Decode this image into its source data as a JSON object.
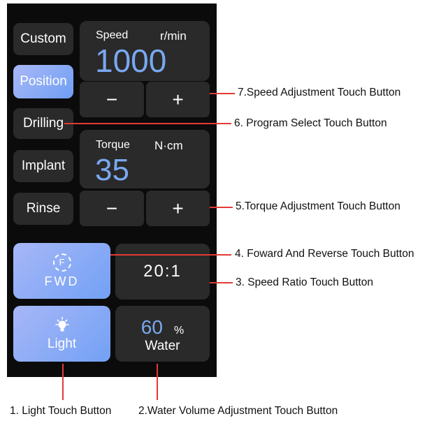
{
  "programs": [
    "Custom",
    "Position",
    "Drilling",
    "Implant",
    "Rinse"
  ],
  "speed": {
    "label": "Speed",
    "unit": "r/min",
    "value": "1000",
    "minus": "−",
    "plus": "+"
  },
  "torque": {
    "label": "Torque",
    "unit": "N·cm",
    "value": "35",
    "minus": "−",
    "plus": "+"
  },
  "fwd": {
    "icon_letter": "F",
    "label": "FWD"
  },
  "ratio": {
    "value": "20:1"
  },
  "light": {
    "label": "Light"
  },
  "water": {
    "value": "60",
    "unit": "%",
    "label": "Water"
  },
  "callouts": {
    "speed_adjust": "7.Speed Adjustment Touch Button",
    "program_select": "6. Program Select Touch Button",
    "torque_adjust": "5.Torque Adjustment Touch Button",
    "fwd_rev": "4. Foward And Reverse Touch Button",
    "speed_ratio": "3. Speed Ratio Touch Button",
    "light": "1. Light Touch Button",
    "water": "2.Water Volume Adjustment Touch Button"
  },
  "colors": {
    "accent": "#79a8f0",
    "panel": "#0b0b0b",
    "button": "#2a2a2a",
    "callout_line": "#e23b36"
  }
}
